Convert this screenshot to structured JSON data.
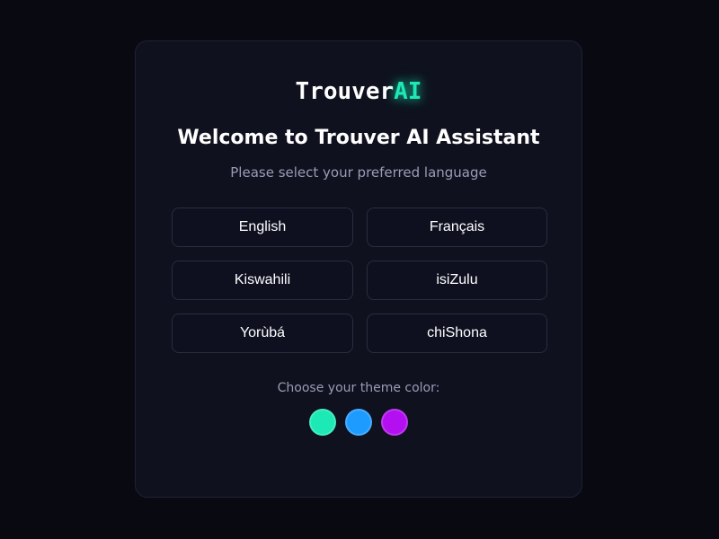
{
  "logo": {
    "text_main": "Trouver",
    "text_accent": "AI"
  },
  "title": "Welcome to Trouver AI Assistant",
  "subtitle": "Please select your preferred language",
  "languages": [
    "English",
    "Français",
    "Kiswahili",
    "isiZulu",
    "Yorùbá",
    "chiShona"
  ],
  "theme": {
    "label": "Choose your theme color:",
    "colors": [
      {
        "name": "teal",
        "hex": "#1de9b6"
      },
      {
        "name": "blue",
        "hex": "#1e9bff"
      },
      {
        "name": "purple",
        "hex": "#b30ff0"
      }
    ]
  },
  "colors": {
    "background": "#080911",
    "card": "#0f111e",
    "accent": "#1de9b6"
  }
}
